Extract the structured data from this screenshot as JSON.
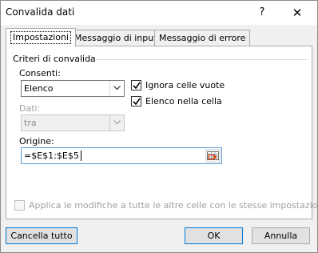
{
  "window": {
    "title": "Convalida dati",
    "help_glyph": "?",
    "close_glyph": "✕"
  },
  "tabs": [
    {
      "label": "Impostazioni",
      "active": true
    },
    {
      "label": "Messaggio di input",
      "active": false
    },
    {
      "label": "Messaggio di errore",
      "active": false
    }
  ],
  "criteria": {
    "group_title": "Criteri di convalida",
    "allow_label": "Consenti:",
    "allow_value": "Elenco",
    "data_label": "Dati:",
    "data_value": "tra",
    "ignore_blank_label": "Ignora celle vuote",
    "ignore_blank_checked": true,
    "in_cell_dropdown_label": "Elenco nella cella",
    "in_cell_dropdown_checked": true,
    "source_label": "Origine:",
    "source_value": "=$E$1:$E$5"
  },
  "apply_all": {
    "label": "Applica le modifiche a tutte le altre celle con le stesse impostazioni",
    "checked": false
  },
  "buttons": {
    "clear_all": "Cancella tutto",
    "ok": "OK",
    "cancel": "Annulla"
  },
  "icons": {
    "dropdown": "chevron-down-icon",
    "range_picker": "collapse-dialog-icon",
    "check": "check-icon"
  }
}
